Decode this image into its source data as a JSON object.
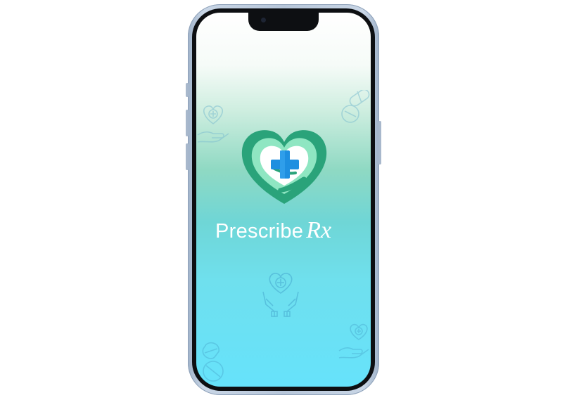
{
  "app": {
    "name": "Prescribe",
    "rx": "Rx"
  },
  "icons": {
    "logo": "heart-hand-cross-icon",
    "center": "heart-hands-care-icon",
    "top_left": "heart-hand-watermark-icon",
    "top_right": "pills-watermark-icon",
    "bottom_left": "pills-watermark-icon",
    "bottom_right": "heart-hand-watermark-icon"
  },
  "colors": {
    "logo_dark_green": "#2aa37a",
    "logo_light_green": "#7fe0b4",
    "cross_blue": "#1e8fe0",
    "screen_top": "#ffffff",
    "screen_bottom": "#66e2fb"
  }
}
